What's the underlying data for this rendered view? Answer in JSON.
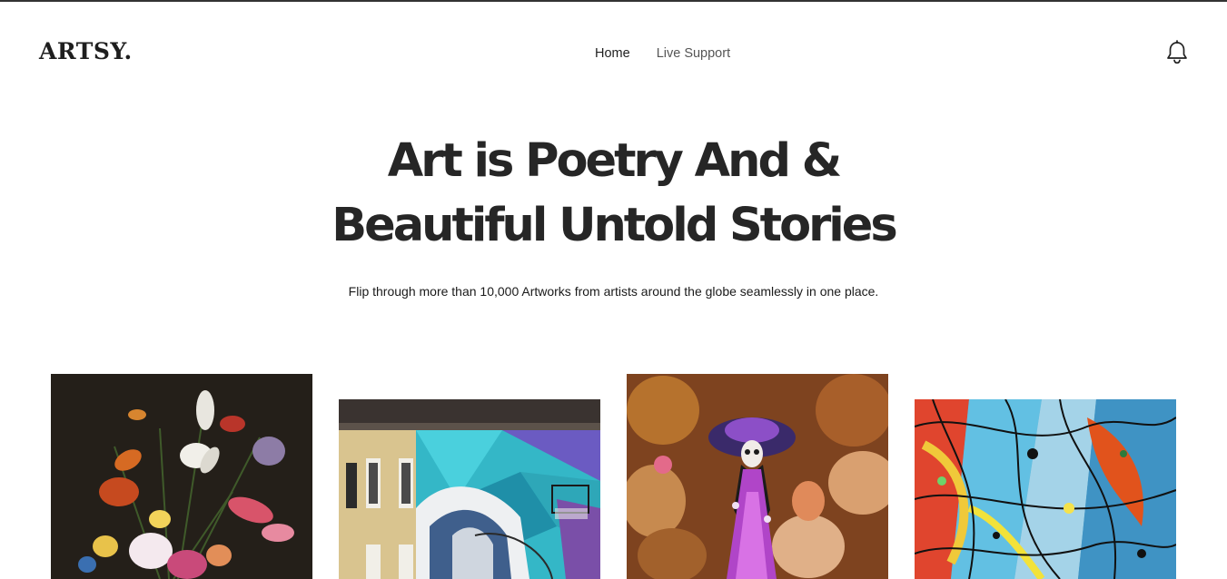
{
  "header": {
    "logo": "ARTSY.",
    "nav": [
      {
        "label": "Home"
      },
      {
        "label": "Live Support"
      }
    ],
    "notification_icon": "bell-icon"
  },
  "hero": {
    "title_line1": "Art is Poetry And &",
    "title_line2": "Beautiful Untold Stories",
    "subtitle": "Flip through more than 10,000 Artworks from artists around the globe seamlessly in one place."
  },
  "gallery": {
    "items": [
      {
        "subject": "flower still life painting"
      },
      {
        "subject": "street mural on building"
      },
      {
        "subject": "day of the dead catrina figure"
      },
      {
        "subject": "abstract splatter painting"
      }
    ]
  },
  "colors": {
    "text": "#262626",
    "background": "#ffffff"
  }
}
